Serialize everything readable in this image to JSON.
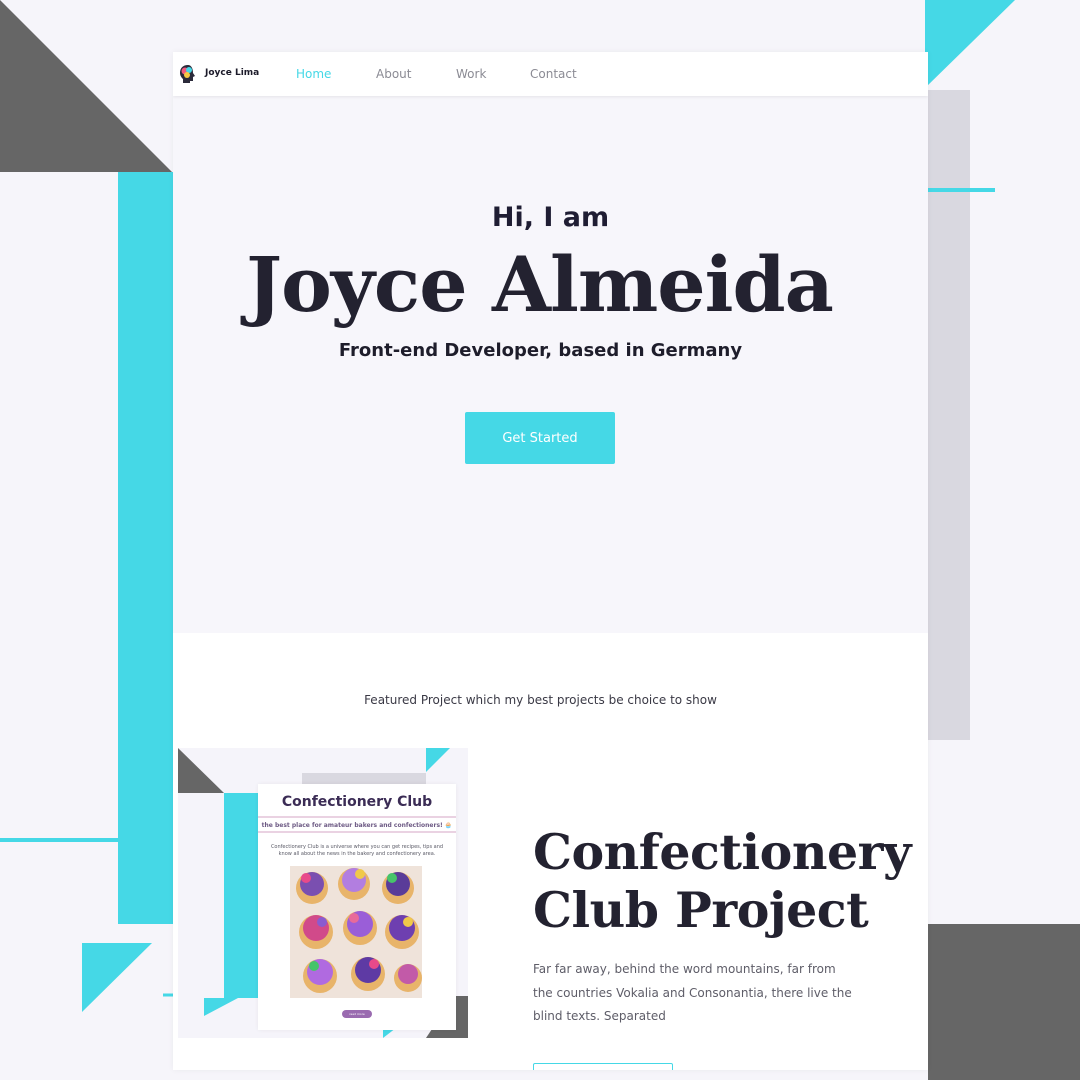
{
  "colors": {
    "accent": "#45d8e6",
    "dark_shape": "#666666",
    "grey_panel": "#d9d8e0",
    "text_dark": "#232230"
  },
  "nav": {
    "brand": "Joyce Lima",
    "logo_icon": "head-silhouette-icon",
    "links": [
      {
        "label": "Home",
        "active": true
      },
      {
        "label": "About",
        "active": false
      },
      {
        "label": "Work",
        "active": false
      },
      {
        "label": "Contact",
        "active": false
      }
    ]
  },
  "hero": {
    "greeting": "Hi, I am",
    "name": "Joyce Almeida",
    "role": "Front-end Developer, based in Germany",
    "cta": "Get Started"
  },
  "projects": {
    "intro": "Featured Project which my best projects be choice to show",
    "featured": {
      "thumb_title": "Confectionery Club",
      "thumb_tagline": "the best place for amateur bakers and confectioners! 🧁",
      "thumb_copy": "Confectionery Club is a universe where you can get recipes, tips and know all about the news in the bakery and confectionery area.",
      "thumb_button": "read more",
      "title_line1": "Confectionery",
      "title_line2": "Club Project",
      "description": "Far far away, behind the word mountains, far from the countries Vokalia and Consonantia, there live the blind texts. Separated"
    }
  }
}
